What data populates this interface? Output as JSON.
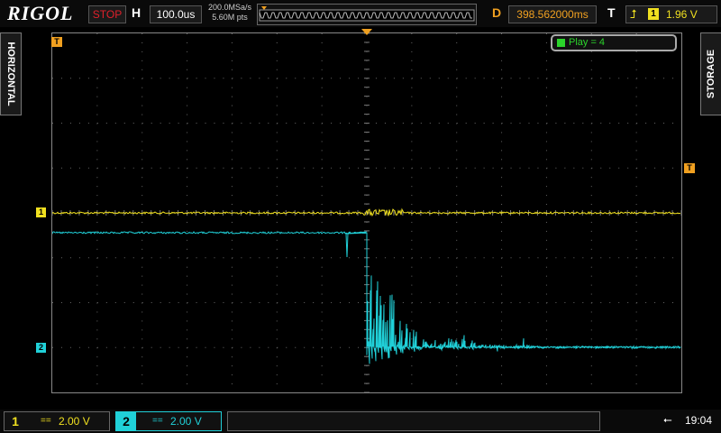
{
  "brand": "RIGOL",
  "run_state": "STOP",
  "timebase": {
    "label": "H",
    "value": "100.0us"
  },
  "sample": {
    "rate": "200.0MSa/s",
    "points": "5.60M pts"
  },
  "delay": {
    "label": "D",
    "value": "398.562000ms"
  },
  "trigger": {
    "label": "T",
    "channel": "1",
    "level": "1.96 V",
    "edge_icon": "rising-edge-icon"
  },
  "left_tab": "HORIZONTAL",
  "right_tab": "STORAGE",
  "play": {
    "text": "Play = 4",
    "color": "#2bd42b"
  },
  "markers": {
    "trigger_marker": "T",
    "ch1_marker": "1",
    "ch2_marker": "2"
  },
  "channels": [
    {
      "num": "1",
      "coupling": "==",
      "scale": "2.00 V",
      "color": "#f0e020"
    },
    {
      "num": "2",
      "coupling": "==",
      "scale": "2.00 V",
      "color": "#20d0d8"
    }
  ],
  "status": {
    "clock": "19:04",
    "usb_icon": "usb-icon"
  },
  "colors": {
    "ch1": "#f0e020",
    "ch2": "#20d0d8",
    "trigger": "#f0a020",
    "stop": "#e0202a"
  },
  "grid": {
    "h_divisions": 14,
    "v_divisions": 8
  }
}
